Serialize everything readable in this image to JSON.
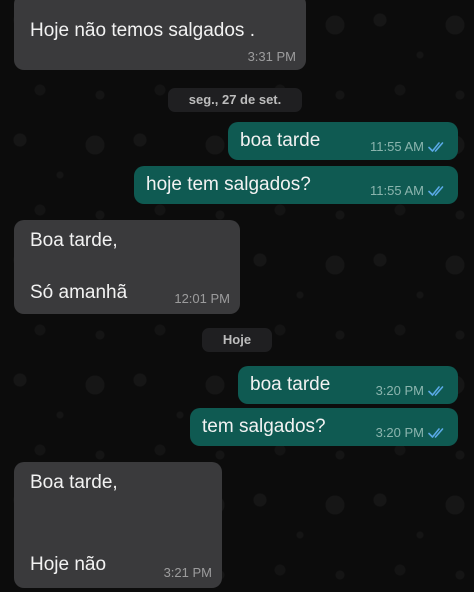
{
  "messages": {
    "m1": {
      "text": "Hoje não temos salgados .",
      "time": "3:31 PM"
    },
    "m2": {
      "text": "boa tarde",
      "time": "11:55 AM"
    },
    "m3": {
      "text": "hoje tem salgados?",
      "time": "11:55 AM"
    },
    "m4": {
      "line1": "Boa tarde,",
      "line2": "Só amanhã",
      "time": "12:01 PM"
    },
    "m5": {
      "text": "boa tarde",
      "time": "3:20 PM"
    },
    "m6": {
      "text": "tem salgados?",
      "time": "3:20 PM"
    },
    "m7": {
      "line1": "Boa tarde,",
      "line2": "Hoje não",
      "time": "3:21 PM"
    }
  },
  "dates": {
    "d1": "seg., 27 de set.",
    "d2": "Hoje"
  },
  "colors": {
    "incoming_bubble": "#3a3a3c",
    "outgoing_bubble": "#0f5a52",
    "read_ticks": "#5aa9e6"
  },
  "icons": {
    "read_receipt": "double-check-icon"
  }
}
